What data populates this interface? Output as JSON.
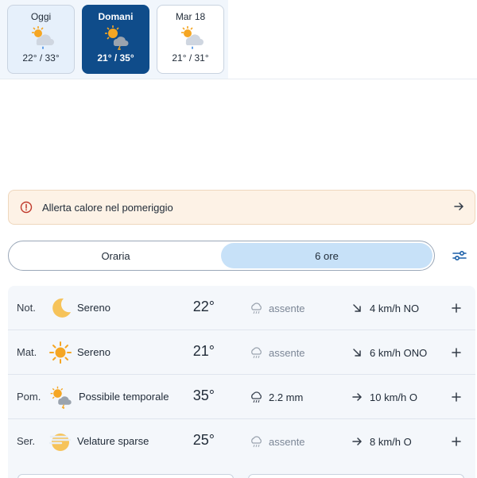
{
  "days": [
    {
      "name": "Oggi",
      "temp": "22° / 33°",
      "icon": "partly-cloudy-rain-icon"
    },
    {
      "name": "Domani",
      "temp": "21° / 35°",
      "icon": "sun-cloud-storm-icon"
    },
    {
      "name": "Mar 18",
      "temp": "21° / 31°",
      "icon": "partly-cloudy-rain-icon"
    }
  ],
  "alert": {
    "text": "Allerta calore nel pomeriggio",
    "icon": "alert-circle-icon"
  },
  "view_toggle": {
    "options": [
      "Oraria",
      "6 ore"
    ],
    "selected": "6 ore"
  },
  "forecast": [
    {
      "period": "Not.",
      "condition": "Sereno",
      "icon": "moon-icon",
      "temp": "22°",
      "rain": "assente",
      "wind": "4 km/h NO"
    },
    {
      "period": "Mat.",
      "condition": "Sereno",
      "icon": "sun-icon",
      "temp": "21°",
      "rain": "assente",
      "wind": "6 km/h ONO"
    },
    {
      "period": "Pom.",
      "condition": "Possibile temporale",
      "icon": "sun-cloud-storm-icon",
      "temp": "35°",
      "rain": "2.2 mm",
      "wind": "10 km/h O"
    },
    {
      "period": "Ser.",
      "condition": "Velature sparse",
      "icon": "hazy-sun-icon",
      "temp": "25°",
      "rain": "assente",
      "wind": "8 km/h O"
    }
  ],
  "colors": {
    "active_day": "#0f4c8a",
    "alert_bg": "#fdf2e6",
    "toggle_selected": "#c7e1f8",
    "sun": "#f5a623"
  }
}
